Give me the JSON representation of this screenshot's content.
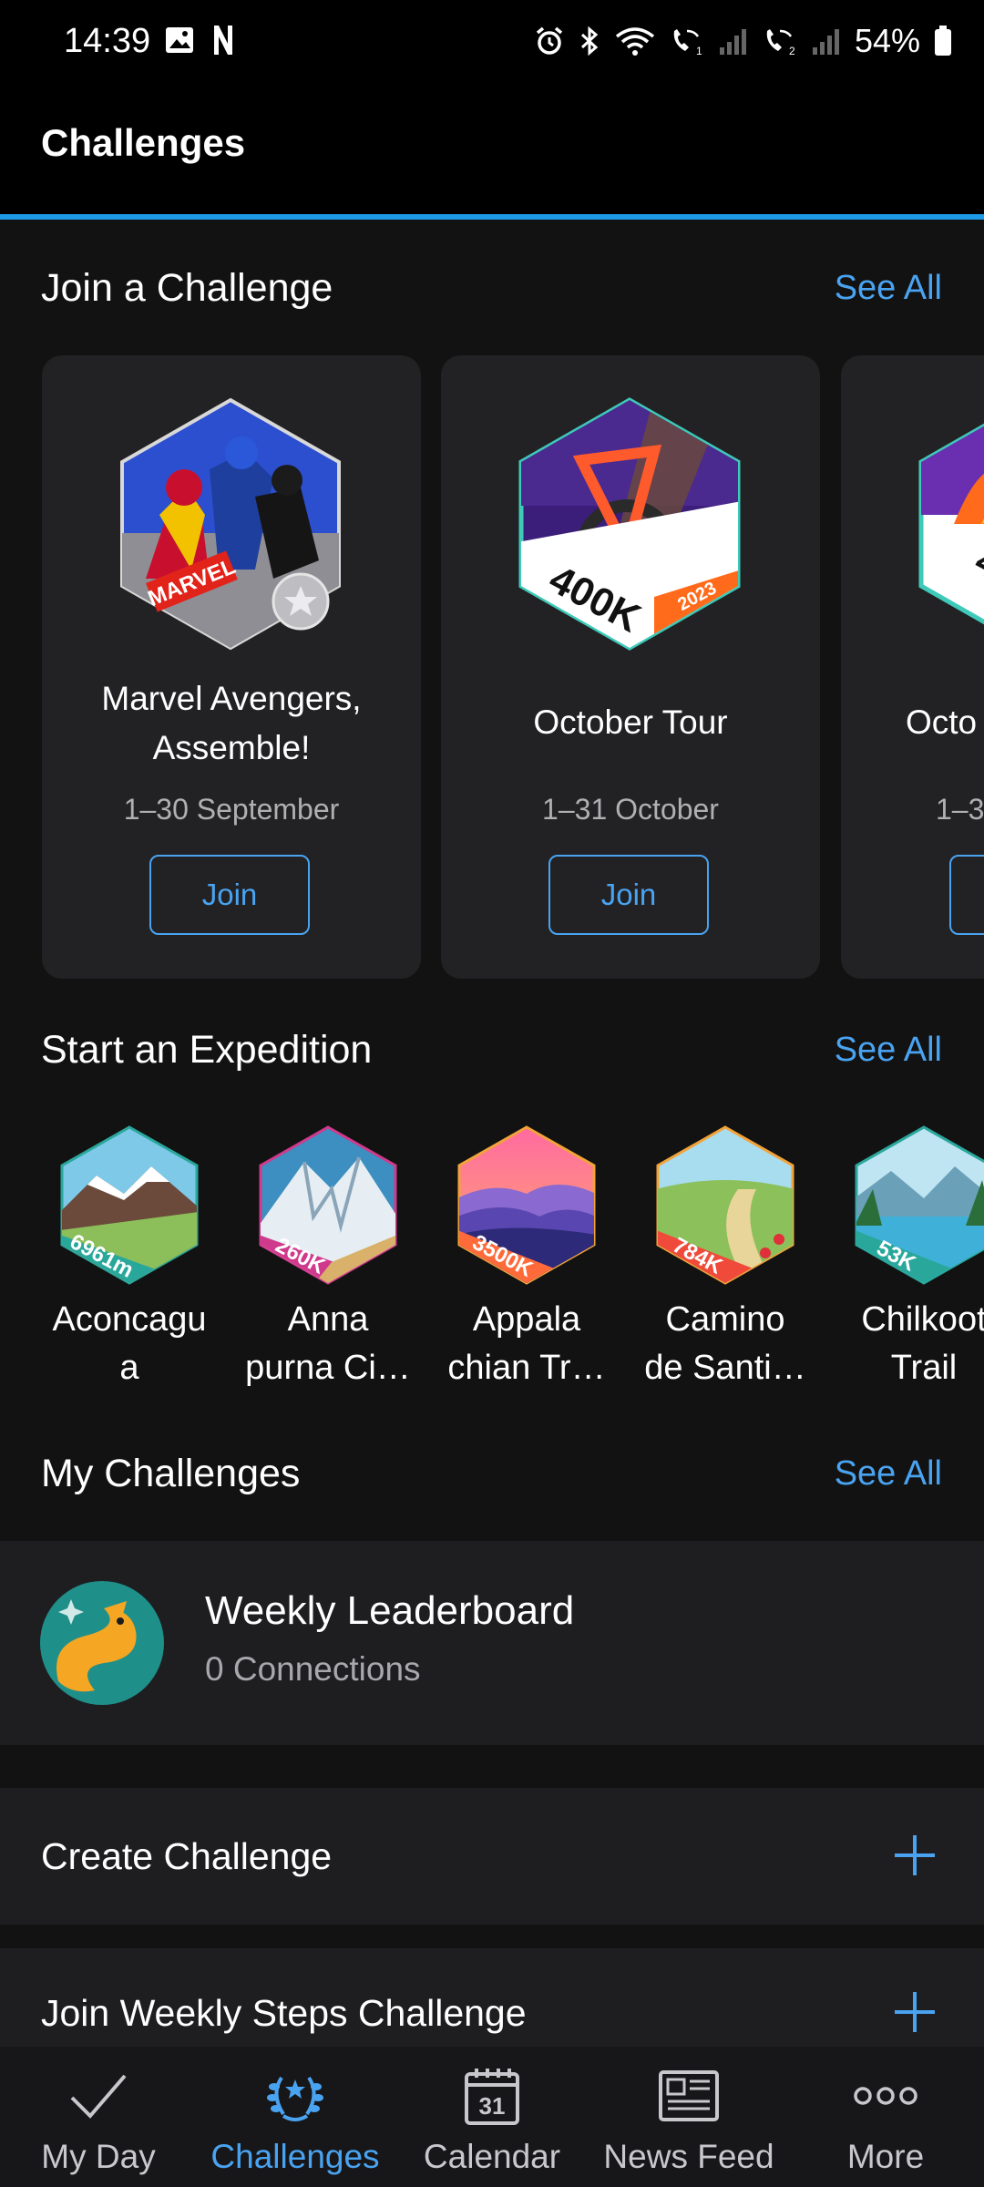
{
  "status": {
    "time": "14:39",
    "battery": "54%"
  },
  "appbar": {
    "title": "Challenges"
  },
  "join_section": {
    "title": "Join a Challenge",
    "see_all": "See All",
    "cards": [
      {
        "title": "Marvel Avengers, Assemble!",
        "date": "1–30 September",
        "button": "Join",
        "badge_text": "MARVEL"
      },
      {
        "title": "October Tour",
        "date": "1–31 October",
        "button": "Join",
        "badge_text": "400K",
        "badge_year": "2023"
      },
      {
        "title": "Octo",
        "date": "1–3",
        "button": "",
        "badge_text": "4:"
      }
    ]
  },
  "expedition_section": {
    "title": "Start an Expedition",
    "see_all": "See All",
    "items": [
      {
        "label_line1": "Aconcagu",
        "label_line2": "a",
        "badge_text": "6961m"
      },
      {
        "label_line1": "Anna",
        "label_line2": "purna Ci…",
        "badge_text": "260K"
      },
      {
        "label_line1": "Appala",
        "label_line2": "chian Tr…",
        "badge_text": "3500K"
      },
      {
        "label_line1": "Camino",
        "label_line2": "de Santi…",
        "badge_text": "784K"
      },
      {
        "label_line1": "Chilkoot",
        "label_line2": "Trail",
        "badge_text": "53K"
      }
    ]
  },
  "my_challenges": {
    "title": "My Challenges",
    "see_all": "See All",
    "item": {
      "title": "Weekly Leaderboard",
      "subtitle": "0 Connections"
    }
  },
  "actions": {
    "create": "Create Challenge",
    "join_weekly": "Join Weekly Steps Challenge"
  },
  "bottom_nav": {
    "items": [
      {
        "label": "My Day",
        "icon": "check-icon"
      },
      {
        "label": "Challenges",
        "icon": "laurel-icon",
        "active": true
      },
      {
        "label": "Calendar",
        "icon": "calendar-icon",
        "day": "31"
      },
      {
        "label": "News Feed",
        "icon": "newspaper-icon"
      },
      {
        "label": "More",
        "icon": "more-dots-icon"
      }
    ]
  },
  "colors": {
    "accent": "#4aa3f0",
    "background": "#121212",
    "card": "#222224"
  }
}
